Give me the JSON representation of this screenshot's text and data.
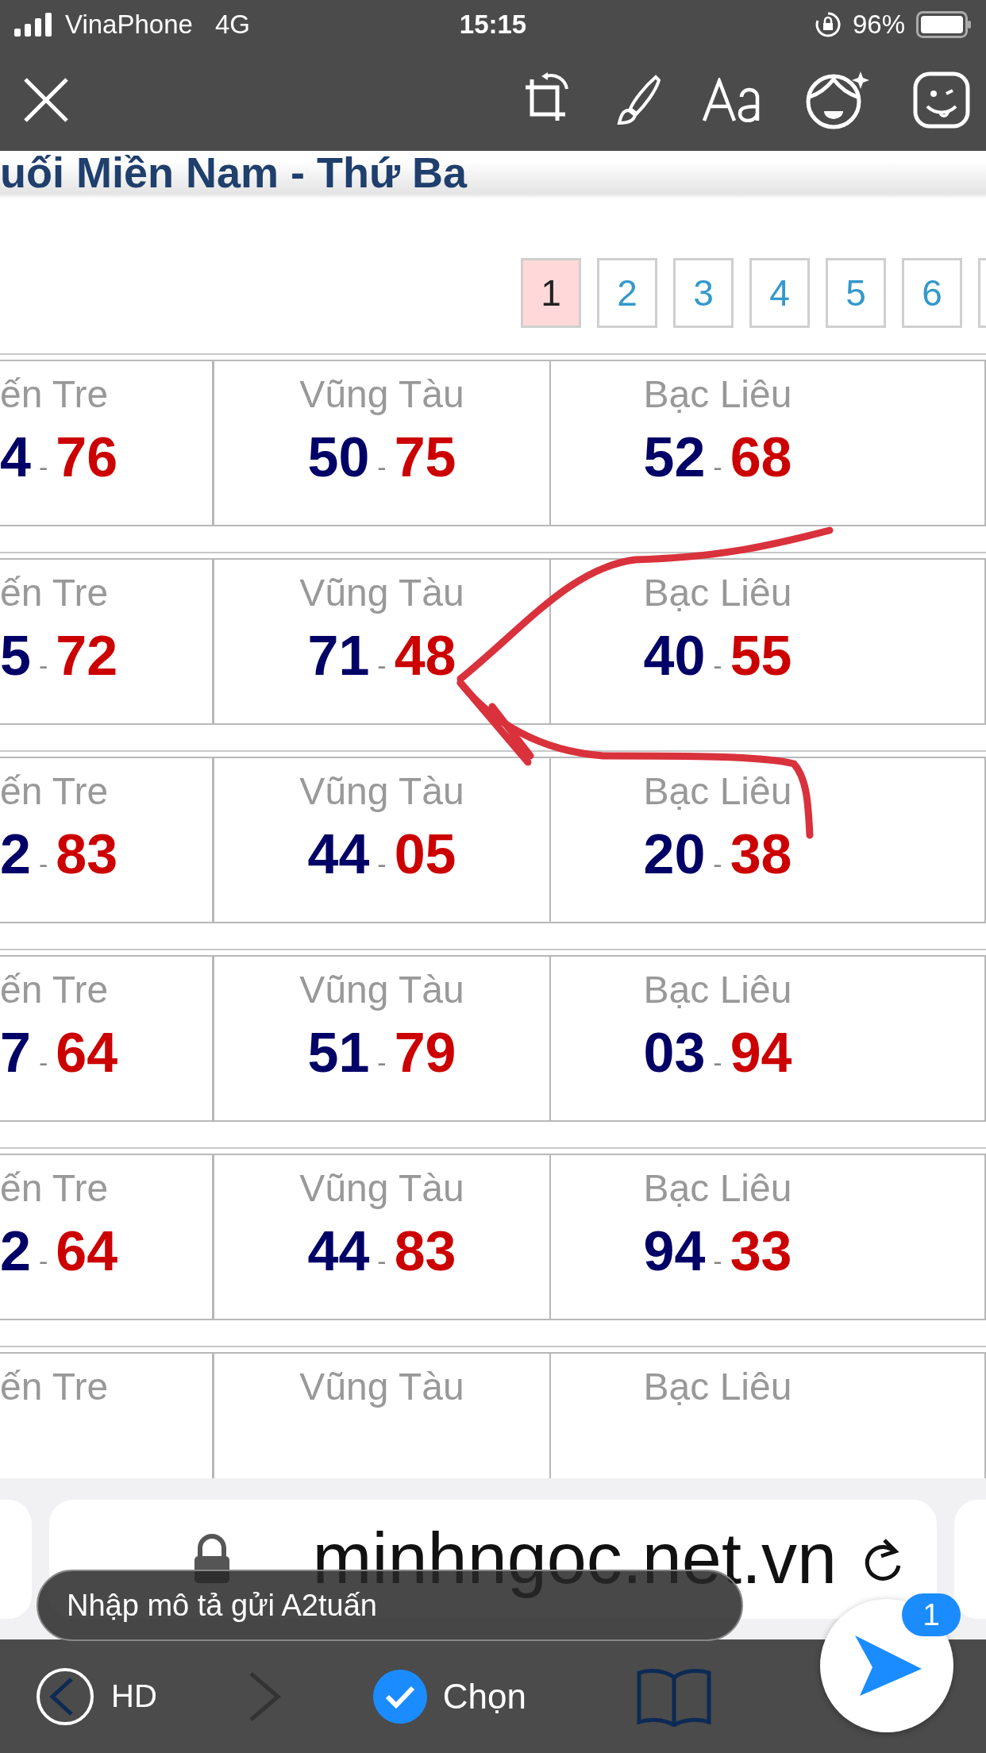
{
  "status_bar": {
    "carrier": "VinaPhone",
    "network": "4G",
    "time": "15:15",
    "battery": "96%"
  },
  "page_title": "uối Miền Nam - Thứ Ba",
  "pages": [
    {
      "label": "1",
      "selected": true
    },
    {
      "label": "2",
      "selected": false
    },
    {
      "label": "3",
      "selected": false
    },
    {
      "label": "4",
      "selected": false
    },
    {
      "label": "5",
      "selected": false
    },
    {
      "label": "6",
      "selected": false
    }
  ],
  "rows": [
    {
      "cells": [
        {
          "name": "ến Tre",
          "first": "4",
          "dash": "-",
          "second": "76"
        },
        {
          "name": "Vũng Tàu",
          "first": "50",
          "dash": "-",
          "second": "75"
        },
        {
          "name": "Bạc Liêu",
          "first": "52",
          "dash": "-",
          "second": "68"
        }
      ]
    },
    {
      "cells": [
        {
          "name": "ến Tre",
          "first": "5",
          "dash": "-",
          "second": "72"
        },
        {
          "name": "Vũng Tàu",
          "first": "71",
          "dash": "-",
          "second": "48"
        },
        {
          "name": "Bạc Liêu",
          "first": "40",
          "dash": "-",
          "second": "55"
        }
      ]
    },
    {
      "cells": [
        {
          "name": "ến Tre",
          "first": "2",
          "dash": "-",
          "second": "83"
        },
        {
          "name": "Vũng Tàu",
          "first": "44",
          "dash": "-",
          "second": "05"
        },
        {
          "name": "Bạc Liêu",
          "first": "20",
          "dash": "-",
          "second": "38"
        }
      ]
    },
    {
      "cells": [
        {
          "name": "ến Tre",
          "first": "7",
          "dash": "-",
          "second": "64"
        },
        {
          "name": "Vũng Tàu",
          "first": "51",
          "dash": "-",
          "second": "79"
        },
        {
          "name": "Bạc Liêu",
          "first": "03",
          "dash": "-",
          "second": "94"
        }
      ]
    },
    {
      "cells": [
        {
          "name": "ến Tre",
          "first": "2",
          "dash": "-",
          "second": "64"
        },
        {
          "name": "Vũng Tàu",
          "first": "44",
          "dash": "-",
          "second": "83"
        },
        {
          "name": "Bạc Liêu",
          "first": "94",
          "dash": "-",
          "second": "33"
        }
      ]
    },
    {
      "cells": [
        {
          "name": "ến Tre"
        },
        {
          "name": "Vũng Tàu"
        },
        {
          "name": "Bạc Liêu"
        }
      ]
    }
  ],
  "address_bar": {
    "url": "minhngoc.net.vn"
  },
  "caption": {
    "placeholder": "Nhập mô tả gửi A2tuấn"
  },
  "send": {
    "badge": "1"
  },
  "bottom_bar": {
    "quality": "HD",
    "select": "Chọn"
  }
}
